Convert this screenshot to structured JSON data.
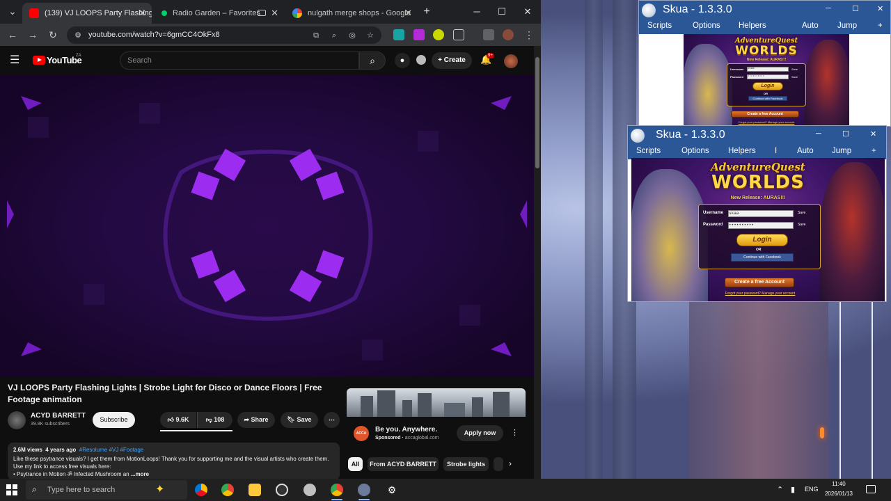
{
  "browser": {
    "tabs": [
      {
        "title": "(139) VJ LOOPS Party Flashing |",
        "favicon_color": "#ff0000",
        "active": true
      },
      {
        "title": "Radio Garden – Favorites",
        "favicon_color": "#00d26a",
        "active": false
      },
      {
        "title": "nulgath merge shops - Google",
        "favicon_color": "#4285f4",
        "active": false
      }
    ],
    "url": "youtube.com/watch?v=6gmCC4OkFx8",
    "new_tab_glyph": "+",
    "close_glyph": "✕"
  },
  "youtube": {
    "logo_text": "YouTube",
    "country_code": "ZA",
    "search_placeholder": "Search",
    "create_label": "Create",
    "notification_count": "9+",
    "video_title": "VJ LOOPS Party Flashing Lights | Strobe Light for Disco or Dance Floors | Free Footage animation",
    "channel_name": "ACYD BARRETT",
    "subscriber_count": "39.8K subscribers",
    "subscribe_label": "Subscribe",
    "likes": "9.6K",
    "dislikes": "108",
    "share_label": "Share",
    "save_label": "Save",
    "views": "2.6M views",
    "age": "4 years ago",
    "tags": "#Resolume #VJ #Footage",
    "description": "Like these psytrance visuals? I get them from MotionLoops! Thank you for supporting me and the visual artists who create them. Use my link to access free visuals here:",
    "description_line2": "• Psytrance in Motion ॐ Infected Mushroom an",
    "more_label": "...more",
    "ad": {
      "logo_text": "ACCA",
      "title": "Be you. Anywhere.",
      "sponsored": "Sponsored",
      "domain": "accaglobal.com",
      "cta": "Apply now"
    },
    "chips": [
      "All",
      "From ACYD BARRETT",
      "Strobe lights"
    ]
  },
  "skua_windows": [
    {
      "title": "Skua - 1.3.3.0",
      "menu": [
        "Scripts",
        "Options",
        "Helpers",
        "Auto",
        "Jump"
      ],
      "game": {
        "logo_line1": "AdventureQuest",
        "logo_line2": "WORLDS",
        "release": "New Release: AURAS!!!",
        "username_label": "Username",
        "password_label": "Password",
        "username_value": "skaa",
        "password_value": "••••••••••",
        "save_label": "Save",
        "login_label": "Login",
        "or_label": "OR",
        "facebook_label": "Continue with Facebook",
        "create_label": "Create a free Account",
        "links": "Forgot your password?    Manage your account"
      }
    },
    {
      "title": "Skua - 1.3.3.0",
      "menu": [
        "Scripts",
        "Options",
        "Helpers",
        "I",
        "Auto",
        "Jump"
      ],
      "game": {
        "logo_line1": "AdventureQuest",
        "logo_line2": "WORLDS",
        "release": "New Release: AURAS!!!",
        "username_label": "Username",
        "password_label": "Password",
        "username_value": "skaa",
        "password_value": "••••••••••",
        "save_label": "Save",
        "login_label": "Login",
        "or_label": "OR",
        "facebook_label": "Continue with Facebook",
        "create_label": "Create a free Account",
        "links": "Forgot your password?    Manage your account"
      }
    }
  ],
  "taskbar": {
    "search_placeholder": "Type here to search",
    "language": "ENG",
    "time": "11:40",
    "date": "2026/01/13"
  },
  "colors": {
    "youtube_red": "#ff0000",
    "link_blue": "#3ea6ff",
    "skua_titlebar": "#2b5797",
    "aqw_gold": "#ffd84a"
  }
}
